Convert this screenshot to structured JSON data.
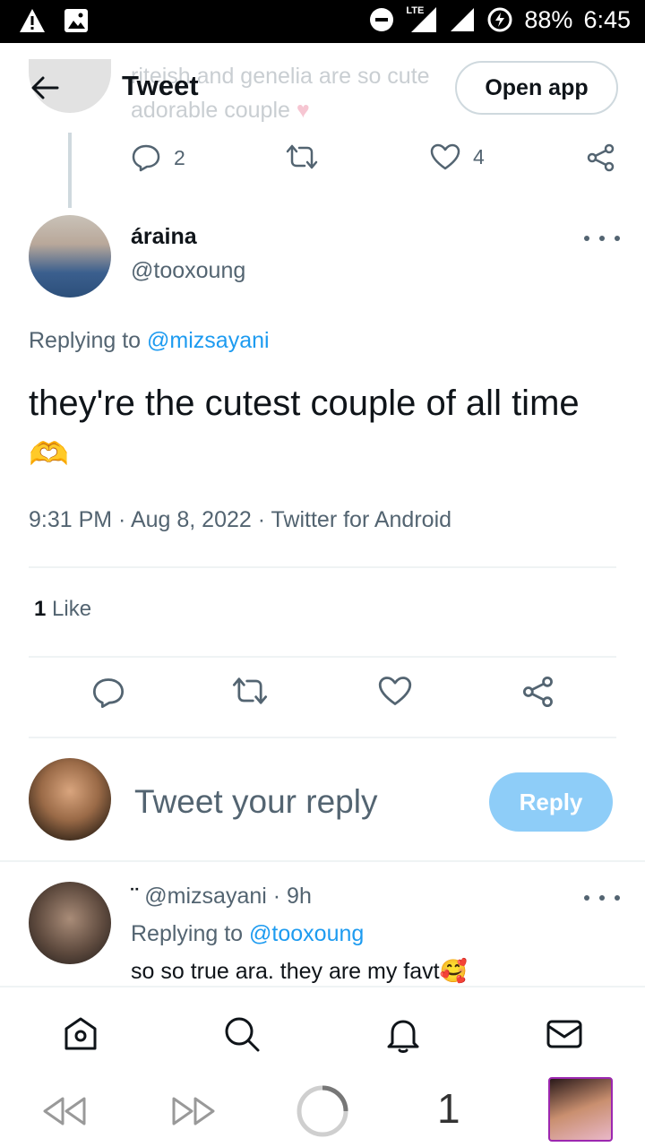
{
  "status_bar": {
    "network": "LTE",
    "battery": "88%",
    "time": "6:45"
  },
  "header": {
    "title": "Tweet",
    "open_app_label": "Open app",
    "ghost_line1": "riteish and genelia are so cute",
    "ghost_line2": "adorable couple"
  },
  "parent_tweet": {
    "reply_count": "2",
    "like_count": "4"
  },
  "main_tweet": {
    "display_name": "áraina",
    "handle": "@tooxoung",
    "replying_prefix": "Replying to",
    "replying_to": "@mizsayani",
    "text": "they're the cutest couple of all time",
    "emoji": "🫶",
    "meta": "9:31 PM · Aug 8, 2022 · Twitter for Android",
    "likes_count": "1",
    "likes_label": "Like"
  },
  "composer": {
    "placeholder": "Tweet your reply",
    "reply_button": "Reply"
  },
  "reply_tweet": {
    "name_glyph": "¨",
    "handle": "@mizsayani",
    "time": "· 9h",
    "replying_prefix": "Replying to",
    "replying_to": "@tooxoung",
    "text": "so so true ara. they are my favt",
    "emoji": "🥰"
  },
  "bottom_nav": {
    "items": [
      "home-icon",
      "search-icon",
      "notifications-icon",
      "messages-icon"
    ]
  },
  "system_nav": {
    "tab_count": "1"
  },
  "colors": {
    "accent": "#1d9bf0",
    "reply_button_disabled": "#8ecdf8",
    "secondary_text": "#536471"
  }
}
